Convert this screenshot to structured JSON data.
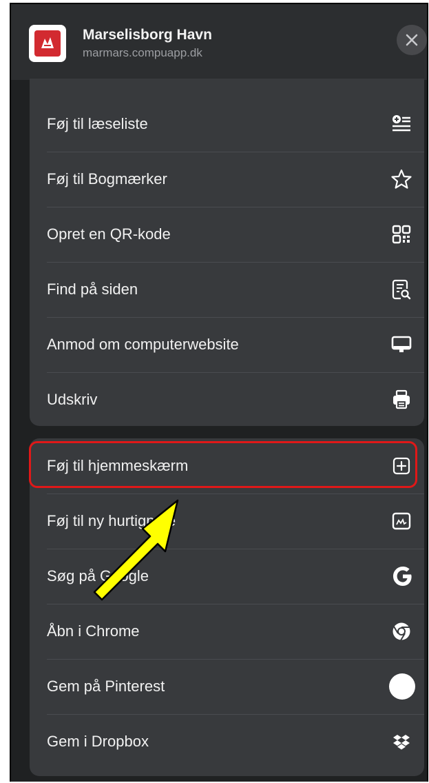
{
  "header": {
    "title": "Marselisborg Havn",
    "url": "marmars.compuapp.dk"
  },
  "menu_group_1": [
    {
      "label": "Føj til læseliste",
      "icon": "reading-list-icon"
    },
    {
      "label": "Føj til Bogmærker",
      "icon": "star-icon"
    },
    {
      "label": "Opret en QR-kode",
      "icon": "qr-code-icon"
    },
    {
      "label": "Find på siden",
      "icon": "find-in-page-icon"
    },
    {
      "label": "Anmod om computerwebsite",
      "icon": "desktop-icon"
    },
    {
      "label": "Udskriv",
      "icon": "printer-icon"
    }
  ],
  "menu_group_2": [
    {
      "label": "Føj til hjemmeskærm",
      "icon": "add-square-icon"
    },
    {
      "label": "Føj til ny hurtignote",
      "icon": "quick-note-icon"
    },
    {
      "label": "Søg på Google",
      "icon": "google-icon"
    },
    {
      "label": "Åbn i Chrome",
      "icon": "chrome-icon"
    },
    {
      "label": "Gem på Pinterest",
      "icon": "pinterest-icon"
    },
    {
      "label": "Gem i Dropbox",
      "icon": "dropbox-icon"
    }
  ],
  "colors": {
    "highlight": "#e01818",
    "arrow_fill": "#ffff00"
  }
}
